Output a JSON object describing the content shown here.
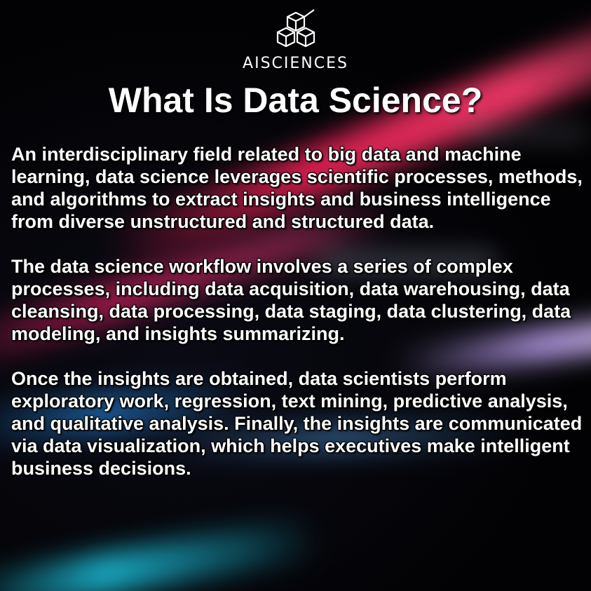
{
  "brand": {
    "name": "AISCIENCES",
    "logo_icon": "cube-cluster-icon"
  },
  "title": "What Is Data Science?",
  "paragraphs": [
    "An interdisciplinary field related to big data and machine learning, data science leverages scientific processes, methods, and algorithms to extract insights and business intelligence from diverse unstructured and structured data.",
    "The data science workflow involves a series of complex processes, including data acquisition, data warehousing, data cleansing, data processing, data staging, data clustering, data modeling, and insights summarizing.",
    "Once the insights are obtained, data scientists perform exploratory work, regression, text mining, predictive analysis, and qualitative analysis. Finally, the insights are communicated via data visualization, which helps executives make intelligent business decisions."
  ],
  "colors": {
    "background": "#000000",
    "text": "#ffffff",
    "accent_pink": "#ff3c6e",
    "accent_cyan": "#1ed2f0",
    "accent_purple": "#c8aaff"
  }
}
